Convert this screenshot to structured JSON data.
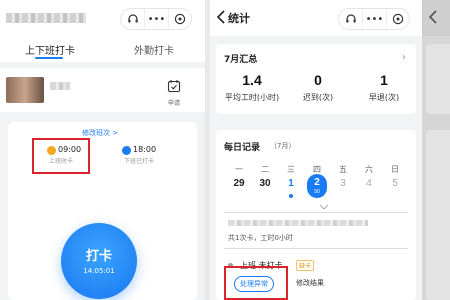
{
  "panel1": {
    "tabs": [
      {
        "label": "上下班打卡"
      },
      {
        "label": "外勤打卡"
      }
    ],
    "apply_label": "申请",
    "edit_shift_label": "修改班次 >",
    "clock_in": {
      "time": "09:00",
      "label": "上班时卡"
    },
    "clock_out": {
      "time": "18:00",
      "label": "下班已打卡"
    },
    "punch": {
      "label": "打卡",
      "time": "14:05:01"
    },
    "colors": {
      "accent": "#1a7cf5",
      "highlight": "#d6262c",
      "clock_in_dot": "#f5a623"
    }
  },
  "panel2": {
    "title": "统计",
    "summary": {
      "title": "7月汇总",
      "stats": [
        {
          "value": "1.4",
          "label": "平均工时(小时)"
        },
        {
          "value": "0",
          "label": "迟到(次)"
        },
        {
          "value": "1",
          "label": "早退(次)"
        }
      ]
    },
    "daily": {
      "title": "每日记录",
      "month_badge": "（7月）",
      "weekdays": [
        "一",
        "二",
        "三",
        "四",
        "五",
        "六",
        "日"
      ],
      "dates": [
        "29",
        "30",
        "1",
        "2",
        "3",
        "4",
        "5"
      ],
      "selected_sub": "50",
      "summary": "共1次卡，工时0小时",
      "record_label": "上班 未打卡",
      "record_badge": "缺卡",
      "handle_btn": "处理异常",
      "result_label": "修改结果"
    }
  }
}
